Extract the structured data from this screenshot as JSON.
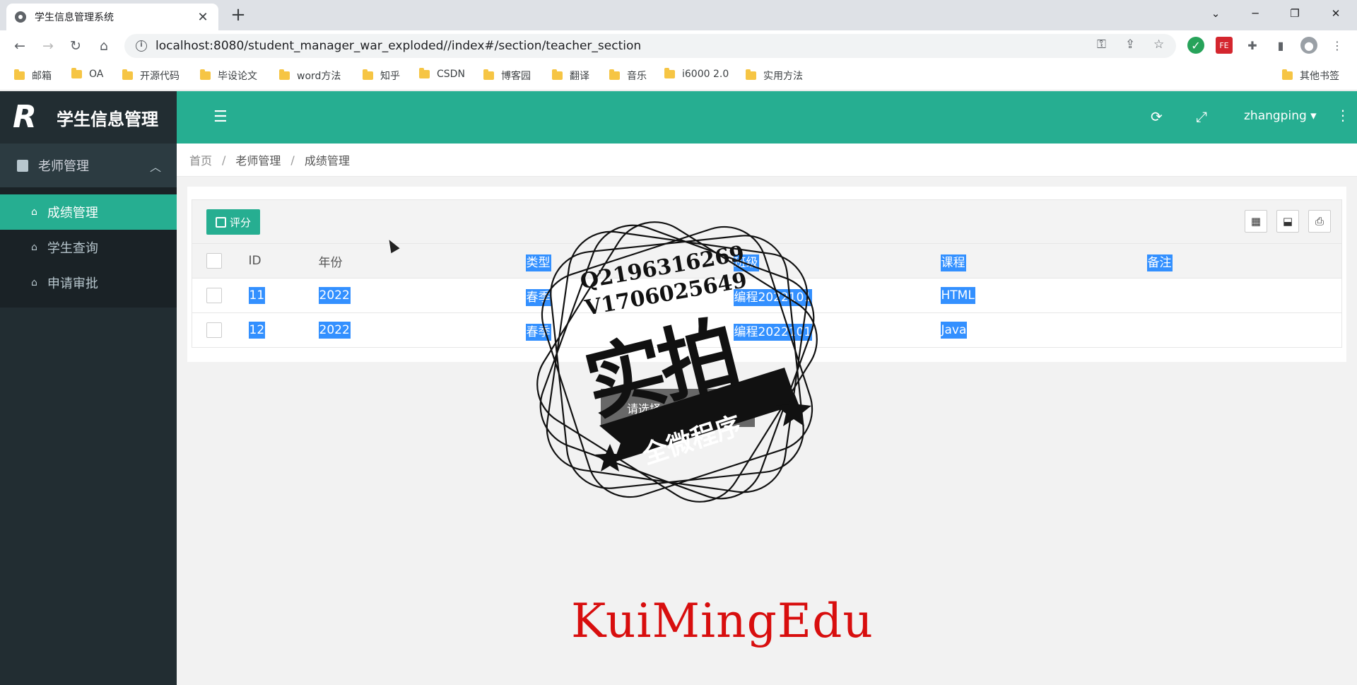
{
  "browser": {
    "tab_title": "学生信息管理系统",
    "url": "localhost:8080/student_manager_war_exploded//index#/section/teacher_section",
    "bookmarks": [
      "邮箱",
      "OA",
      "开源代码",
      "毕设论文",
      "word方法",
      "知乎",
      "CSDN",
      "博客园",
      "翻译",
      "音乐",
      "i6000 2.0",
      "实用方法"
    ],
    "other_bookmarks": "其他书签"
  },
  "app": {
    "brand_logo": "R",
    "brand_title": "学生信息管理",
    "accent_color": "#26ae91",
    "sidebar": {
      "group_label": "老师管理",
      "items": [
        {
          "label": "成绩管理",
          "active": true
        },
        {
          "label": "学生查询",
          "active": false
        },
        {
          "label": "申请审批",
          "active": false
        }
      ]
    },
    "topnav": {
      "user": "zhangping"
    },
    "breadcrumb": [
      "首页",
      "老师管理",
      "成绩管理"
    ],
    "toolbar": {
      "rate_label": "评分"
    },
    "table": {
      "headers": [
        "ID",
        "年份",
        "类型",
        "班级",
        "课程",
        "备注"
      ],
      "rows": [
        [
          "11",
          "2022",
          "春季",
          "编程2022101",
          "HTML",
          ""
        ],
        [
          "12",
          "2022",
          "春季",
          "编程2022101",
          "Java",
          ""
        ]
      ]
    },
    "toast": "请选择一条数据评分"
  },
  "watermark": {
    "stamp_line1": "Q2196316269",
    "stamp_line2": "V1706025649",
    "stamp_big": "实拍",
    "stamp_ribbon": "全微程序",
    "bottom_text": "KuiMingEdu"
  }
}
